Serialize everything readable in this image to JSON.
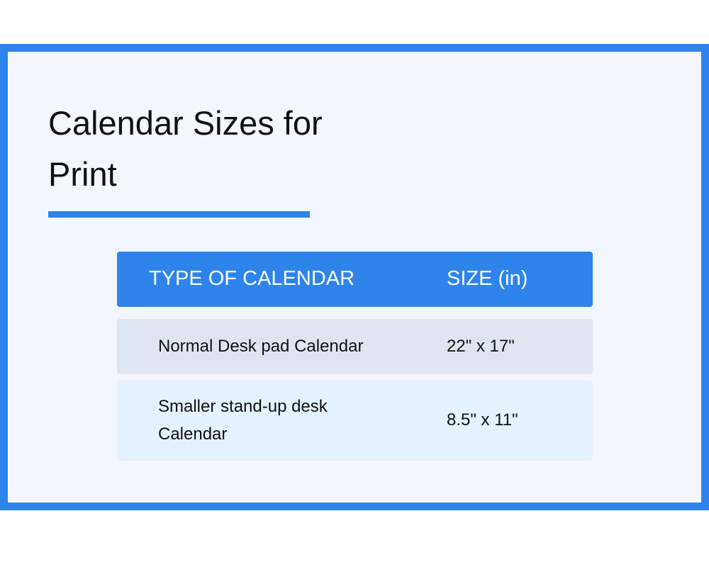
{
  "title": "Calendar Sizes for Print",
  "colors": {
    "accent": "#2e84ea",
    "background": "#f2f7fd",
    "row_1": "#dde6f0",
    "row_2": "#e3f2fd"
  },
  "table": {
    "headers": [
      "TYPE OF CALENDAR",
      "SIZE (in)"
    ],
    "rows": [
      [
        "Normal Desk pad Calendar",
        "22\" x 17\""
      ],
      [
        "Smaller stand-up desk Calendar",
        "8.5\" x 11\""
      ]
    ]
  }
}
